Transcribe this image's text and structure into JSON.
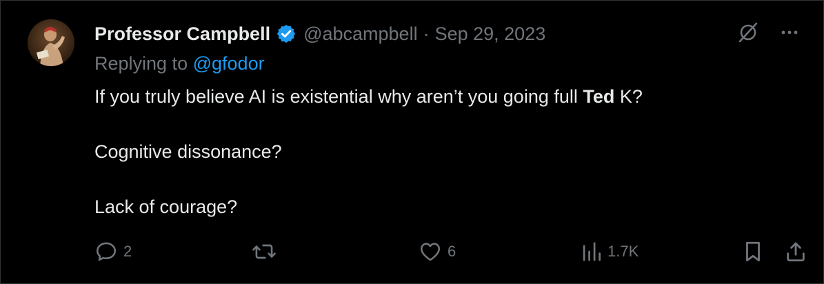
{
  "author": {
    "name": "Professor Campbell",
    "handle": "@abcampbell",
    "separator": "·",
    "date": "Sep 29, 2023",
    "verified_color": "#1d9bf0"
  },
  "reply": {
    "prefix": "Replying to",
    "mention": "@gfodor"
  },
  "body": {
    "line1_before": "If you truly believe AI is existential why  aren’t you going full ",
    "line1_bold": "Ted",
    "line1_after": " K?",
    "line2": "Cognitive dissonance?",
    "line3": "Lack of courage?"
  },
  "top_icons": [
    "grok-icon",
    "more-icon"
  ],
  "actions": {
    "replies": "2",
    "retweets": "",
    "likes": "6",
    "views": "1.7K"
  },
  "colors": {
    "background": "#000000",
    "text": "#e7e9ea",
    "muted": "#71767b",
    "accent": "#1d9bf0"
  }
}
